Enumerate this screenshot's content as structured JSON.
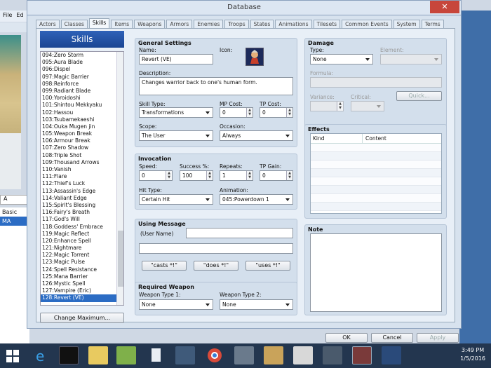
{
  "window": {
    "title": "Database",
    "close_glyph": "✕"
  },
  "background": {
    "menu_file": "File",
    "menu_edit": "Ed",
    "left_tab": "A",
    "maplist": [
      "Basic",
      "MA"
    ]
  },
  "tabs": [
    "Actors",
    "Classes",
    "Skills",
    "Items",
    "Weapons",
    "Armors",
    "Enemies",
    "Troops",
    "States",
    "Animations",
    "Tilesets",
    "Common Events",
    "System",
    "Terms"
  ],
  "active_tab": "Skills",
  "skills": {
    "header": "Skills",
    "items": [
      "094:Zero Storm",
      "095:Aura Blade",
      "096:Dispel",
      "097:Magic Barrier",
      "098:Reinforce",
      "099:Radiant Blade",
      "100:Yoroidoshi",
      "101:Shintou Mekkyaku",
      "102:Hassou",
      "103:Tsubamekaeshi",
      "104:Ouka Mugen jin",
      "105:Weapon Break",
      "106:Armour Break",
      "107:Zero Shadow",
      "108:Triple Shot",
      "109:Thousand Arrows",
      "110:Vanish",
      "111:Flare",
      "112:Thief's Luck",
      "113:Assassin's Edge",
      "114:Valiant Edge",
      "115:Spirit's Blessing",
      "116:Fairy's Breath",
      "117:God's Will",
      "118:Goddess' Embrace",
      "119:Magic Reflect",
      "120:Enhance Spell",
      "121:Nightmare",
      "122:Magic Torrent",
      "123:Magic Pulse",
      "124:Spell Resistance",
      "125:Mana Barrier",
      "126:Mystic Spell",
      "127:Vampire (Eric)",
      "128:Revert (VE)"
    ],
    "selected": "128:Revert (VE)",
    "change_max": "Change Maximum..."
  },
  "general": {
    "title": "General Settings",
    "name_label": "Name:",
    "name": "Revert (VE)",
    "icon_label": "Icon:",
    "desc_label": "Description:",
    "description": "Changes warrior back to one's human form.",
    "skill_type_label": "Skill Type:",
    "skill_type": "Transformations",
    "mp_label": "MP Cost:",
    "mp": "0",
    "tp_label": "TP Cost:",
    "tp": "0",
    "scope_label": "Scope:",
    "scope": "The User",
    "occasion_label": "Occasion:",
    "occasion": "Always"
  },
  "invocation": {
    "title": "Invocation",
    "speed_label": "Speed:",
    "speed": "0",
    "success_label": "Success %:",
    "success": "100",
    "repeats_label": "Repeats:",
    "repeats": "1",
    "tpgain_label": "TP Gain:",
    "tpgain": "0",
    "hittype_label": "Hit Type:",
    "hittype": "Certain Hit",
    "animation_label": "Animation:",
    "animation": "045:Powerdown 1"
  },
  "message": {
    "title": "Using Message",
    "user_label": "(User Name)",
    "line1": "",
    "line2": "",
    "btn1": "\"casts *!\"",
    "btn2": "\"does *!\"",
    "btn3": "\"uses *!\""
  },
  "weapon": {
    "title": "Required Weapon",
    "w1_label": "Weapon Type 1:",
    "w1": "None",
    "w2_label": "Weapon Type 2:",
    "w2": "None"
  },
  "damage": {
    "title": "Damage",
    "type_label": "Type:",
    "type": "None",
    "element_label": "Element:",
    "formula_label": "Formula:",
    "variance_label": "Variance:",
    "critical_label": "Critical:",
    "quick": "Quick..."
  },
  "effects": {
    "title": "Effects",
    "col_kind": "Kind",
    "col_content": "Content"
  },
  "note": {
    "title": "Note"
  },
  "footer": {
    "ok": "OK",
    "cancel": "Cancel",
    "apply": "Apply"
  },
  "taskbar": {
    "time": "3:49 PM",
    "date": "1/5/2016"
  },
  "colors": {
    "accent": "#2b6cc4",
    "close": "#c7463b",
    "taskbar": "#23364f"
  }
}
